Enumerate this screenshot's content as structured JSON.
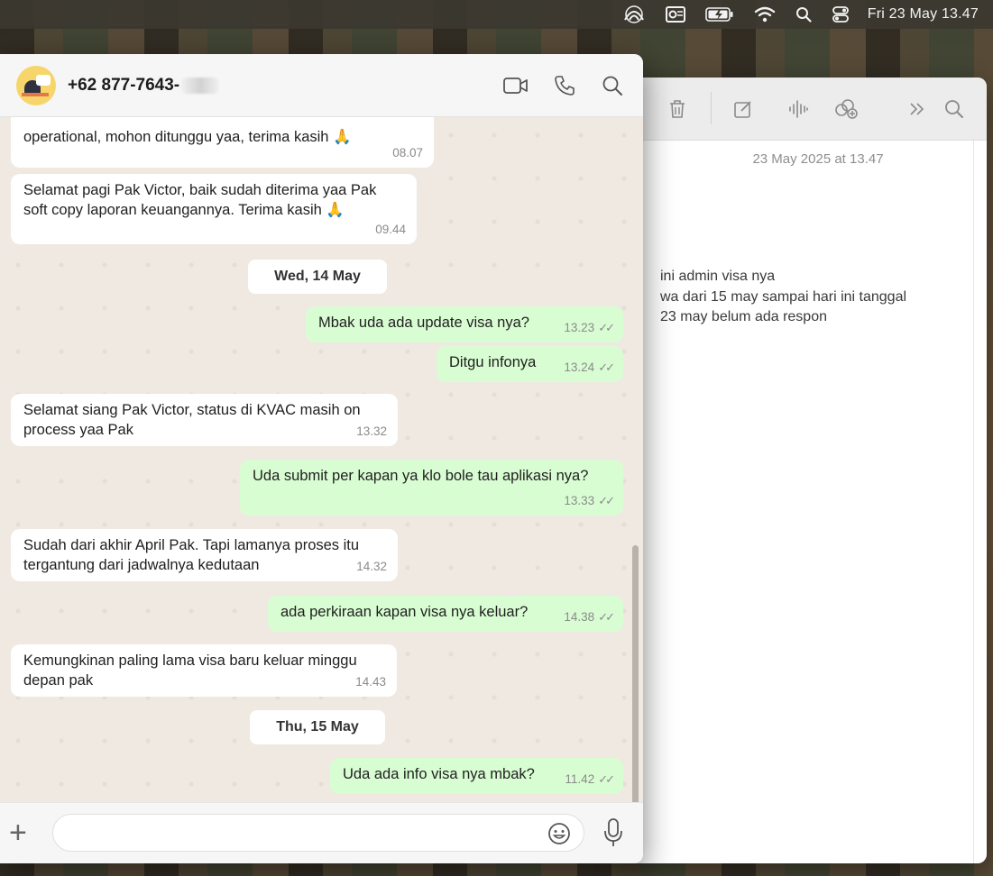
{
  "menubar": {
    "clock": "Fri 23 May  13.47",
    "icons": [
      "creative-cloud-icon",
      "outlook-icon",
      "battery-icon",
      "wifi-icon",
      "spotlight-search-icon",
      "control-center-icon"
    ]
  },
  "whatsapp": {
    "contact_name": "+62 877-7643-",
    "header_icons": [
      "video-call-icon",
      "phone-call-icon",
      "search-icon"
    ],
    "messages": [
      {
        "dir": "in",
        "text": "operational, mohon ditunggu yaa, terima kasih 🙏",
        "time": "08.07"
      },
      {
        "dir": "in",
        "text": "Selamat pagi Pak Victor, baik sudah diterima yaa Pak soft copy laporan keuangannya. Terima kasih 🙏",
        "time": "09.44"
      },
      {
        "dir": "date",
        "text": "Wed, 14 May"
      },
      {
        "dir": "out",
        "text": "Mbak uda ada update visa nya?",
        "time": "13.23"
      },
      {
        "dir": "out",
        "text": "Ditgu infonya",
        "time": "13.24"
      },
      {
        "dir": "in",
        "text": "Selamat siang Pak Victor, status di KVAC masih on process yaa Pak",
        "time": "13.32"
      },
      {
        "dir": "out",
        "text": "Uda submit per kapan ya klo bole tau aplikasi nya?",
        "time": "13.33"
      },
      {
        "dir": "in",
        "text": "Sudah dari akhir April Pak. Tapi lamanya proses itu tergantung dari jadwalnya kedutaan",
        "time": "14.32"
      },
      {
        "dir": "out",
        "text": "ada perkiraan kapan visa nya keluar?",
        "time": "14.38"
      },
      {
        "dir": "in",
        "text": "Kemungkinan paling lama visa baru keluar minggu depan pak",
        "time": "14.43"
      },
      {
        "dir": "date",
        "text": "Thu, 15 May"
      },
      {
        "dir": "out",
        "text": "Uda ada info visa nya mbak?",
        "time": "11.42"
      }
    ],
    "tick": "✓✓",
    "input_placeholder": ""
  },
  "notes": {
    "toolbar_icons": [
      "trash-icon",
      "compose-icon",
      "audio-icon",
      "collaborate-icon",
      "more-chevron-icon",
      "search-icon"
    ],
    "date": "23 May 2025 at 13.47",
    "lines": [
      "ini admin visa nya",
      "wa dari 15 may sampai hari ini tanggal",
      "23 may belum ada respon"
    ]
  }
}
